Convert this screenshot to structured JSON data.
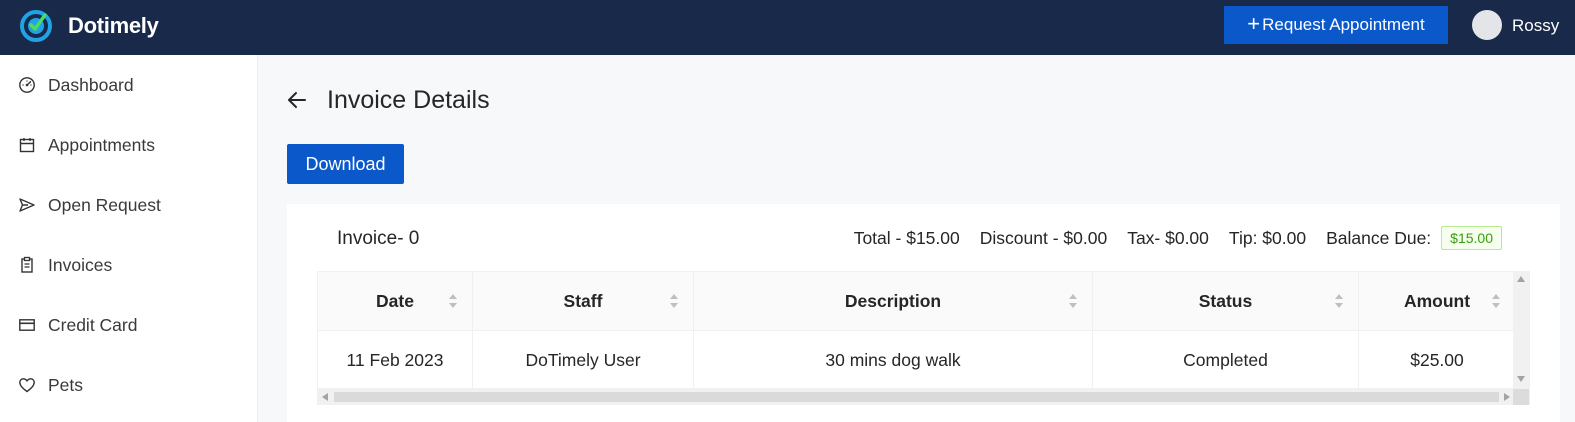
{
  "app": {
    "brand": "Dotimely",
    "accent": "#0a58ca",
    "topbar_color": "#18294a"
  },
  "header": {
    "request_button_label": "Request Appointment",
    "request_button_icon": "plus-icon",
    "user_name": "Rossy"
  },
  "sidebar": {
    "items": [
      {
        "label": "Dashboard",
        "icon": "dashboard-icon"
      },
      {
        "label": "Appointments",
        "icon": "calendar-icon"
      },
      {
        "label": "Open Request",
        "icon": "send-icon"
      },
      {
        "label": "Invoices",
        "icon": "invoice-icon"
      },
      {
        "label": "Credit Card",
        "icon": "credit-card-icon"
      },
      {
        "label": "Pets",
        "icon": "heart-icon"
      }
    ]
  },
  "main": {
    "title": "Invoice Details",
    "download_label": "Download",
    "invoice": {
      "number_label": "Invoice- 0",
      "total": "Total - $15.00",
      "discount": "Discount - $0.00",
      "tax": "Tax- $0.00",
      "tip": "Tip: $0.00",
      "balance_label": "Balance Due:",
      "balance_value": "$15.00",
      "balance_color": "#389e0d"
    },
    "table": {
      "columns": [
        "Date",
        "Staff",
        "Description",
        "Status",
        "Amount"
      ],
      "rows": [
        [
          "11 Feb 2023",
          "DoTimely User",
          "30 mins dog walk",
          "Completed",
          "$25.00"
        ]
      ]
    }
  }
}
